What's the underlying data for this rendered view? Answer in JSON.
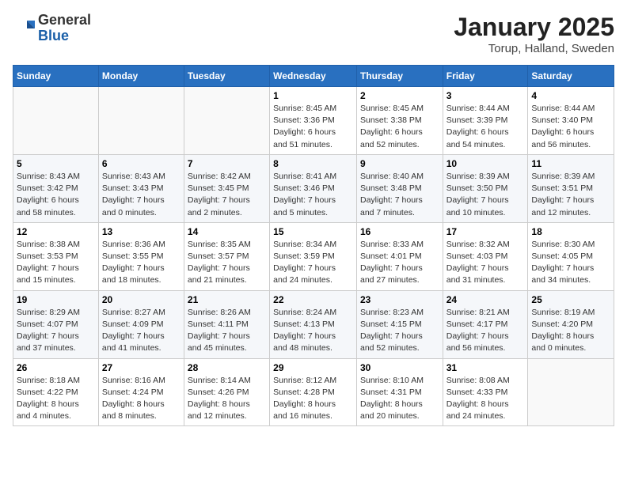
{
  "header": {
    "logo_general": "General",
    "logo_blue": "Blue",
    "month_title": "January 2025",
    "location": "Torup, Halland, Sweden"
  },
  "weekdays": [
    "Sunday",
    "Monday",
    "Tuesday",
    "Wednesday",
    "Thursday",
    "Friday",
    "Saturday"
  ],
  "weeks": [
    [
      {
        "day": "",
        "info": ""
      },
      {
        "day": "",
        "info": ""
      },
      {
        "day": "",
        "info": ""
      },
      {
        "day": "1",
        "info": "Sunrise: 8:45 AM\nSunset: 3:36 PM\nDaylight: 6 hours\nand 51 minutes."
      },
      {
        "day": "2",
        "info": "Sunrise: 8:45 AM\nSunset: 3:38 PM\nDaylight: 6 hours\nand 52 minutes."
      },
      {
        "day": "3",
        "info": "Sunrise: 8:44 AM\nSunset: 3:39 PM\nDaylight: 6 hours\nand 54 minutes."
      },
      {
        "day": "4",
        "info": "Sunrise: 8:44 AM\nSunset: 3:40 PM\nDaylight: 6 hours\nand 56 minutes."
      }
    ],
    [
      {
        "day": "5",
        "info": "Sunrise: 8:43 AM\nSunset: 3:42 PM\nDaylight: 6 hours\nand 58 minutes."
      },
      {
        "day": "6",
        "info": "Sunrise: 8:43 AM\nSunset: 3:43 PM\nDaylight: 7 hours\nand 0 minutes."
      },
      {
        "day": "7",
        "info": "Sunrise: 8:42 AM\nSunset: 3:45 PM\nDaylight: 7 hours\nand 2 minutes."
      },
      {
        "day": "8",
        "info": "Sunrise: 8:41 AM\nSunset: 3:46 PM\nDaylight: 7 hours\nand 5 minutes."
      },
      {
        "day": "9",
        "info": "Sunrise: 8:40 AM\nSunset: 3:48 PM\nDaylight: 7 hours\nand 7 minutes."
      },
      {
        "day": "10",
        "info": "Sunrise: 8:39 AM\nSunset: 3:50 PM\nDaylight: 7 hours\nand 10 minutes."
      },
      {
        "day": "11",
        "info": "Sunrise: 8:39 AM\nSunset: 3:51 PM\nDaylight: 7 hours\nand 12 minutes."
      }
    ],
    [
      {
        "day": "12",
        "info": "Sunrise: 8:38 AM\nSunset: 3:53 PM\nDaylight: 7 hours\nand 15 minutes."
      },
      {
        "day": "13",
        "info": "Sunrise: 8:36 AM\nSunset: 3:55 PM\nDaylight: 7 hours\nand 18 minutes."
      },
      {
        "day": "14",
        "info": "Sunrise: 8:35 AM\nSunset: 3:57 PM\nDaylight: 7 hours\nand 21 minutes."
      },
      {
        "day": "15",
        "info": "Sunrise: 8:34 AM\nSunset: 3:59 PM\nDaylight: 7 hours\nand 24 minutes."
      },
      {
        "day": "16",
        "info": "Sunrise: 8:33 AM\nSunset: 4:01 PM\nDaylight: 7 hours\nand 27 minutes."
      },
      {
        "day": "17",
        "info": "Sunrise: 8:32 AM\nSunset: 4:03 PM\nDaylight: 7 hours\nand 31 minutes."
      },
      {
        "day": "18",
        "info": "Sunrise: 8:30 AM\nSunset: 4:05 PM\nDaylight: 7 hours\nand 34 minutes."
      }
    ],
    [
      {
        "day": "19",
        "info": "Sunrise: 8:29 AM\nSunset: 4:07 PM\nDaylight: 7 hours\nand 37 minutes."
      },
      {
        "day": "20",
        "info": "Sunrise: 8:27 AM\nSunset: 4:09 PM\nDaylight: 7 hours\nand 41 minutes."
      },
      {
        "day": "21",
        "info": "Sunrise: 8:26 AM\nSunset: 4:11 PM\nDaylight: 7 hours\nand 45 minutes."
      },
      {
        "day": "22",
        "info": "Sunrise: 8:24 AM\nSunset: 4:13 PM\nDaylight: 7 hours\nand 48 minutes."
      },
      {
        "day": "23",
        "info": "Sunrise: 8:23 AM\nSunset: 4:15 PM\nDaylight: 7 hours\nand 52 minutes."
      },
      {
        "day": "24",
        "info": "Sunrise: 8:21 AM\nSunset: 4:17 PM\nDaylight: 7 hours\nand 56 minutes."
      },
      {
        "day": "25",
        "info": "Sunrise: 8:19 AM\nSunset: 4:20 PM\nDaylight: 8 hours\nand 0 minutes."
      }
    ],
    [
      {
        "day": "26",
        "info": "Sunrise: 8:18 AM\nSunset: 4:22 PM\nDaylight: 8 hours\nand 4 minutes."
      },
      {
        "day": "27",
        "info": "Sunrise: 8:16 AM\nSunset: 4:24 PM\nDaylight: 8 hours\nand 8 minutes."
      },
      {
        "day": "28",
        "info": "Sunrise: 8:14 AM\nSunset: 4:26 PM\nDaylight: 8 hours\nand 12 minutes."
      },
      {
        "day": "29",
        "info": "Sunrise: 8:12 AM\nSunset: 4:28 PM\nDaylight: 8 hours\nand 16 minutes."
      },
      {
        "day": "30",
        "info": "Sunrise: 8:10 AM\nSunset: 4:31 PM\nDaylight: 8 hours\nand 20 minutes."
      },
      {
        "day": "31",
        "info": "Sunrise: 8:08 AM\nSunset: 4:33 PM\nDaylight: 8 hours\nand 24 minutes."
      },
      {
        "day": "",
        "info": ""
      }
    ]
  ]
}
